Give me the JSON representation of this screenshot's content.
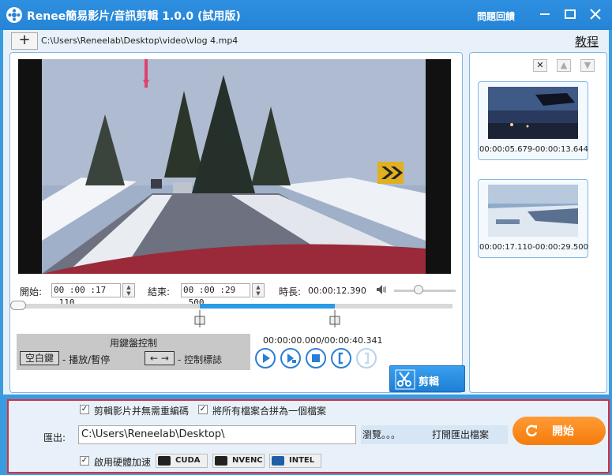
{
  "window": {
    "title": "Renee簡易影片/音訊剪輯 1.0.0 (試用版)",
    "feedback_label": "問題回饋"
  },
  "toolbar": {
    "add_label": "+",
    "file_path": "C:\\Users\\Reneelab\\Desktop\\video\\vlog 4.mp4",
    "tutorial_label": "教程"
  },
  "trim": {
    "start_label": "開始:",
    "start_value": "00 :00 :17 .110",
    "end_label": "結束:",
    "end_value": "00 :00 :29 .500",
    "duration_label": "時長:",
    "duration_value": "00:00:12.390"
  },
  "timeline": {
    "total_seconds": 40.341,
    "selection_start_seconds": 17.11,
    "selection_end_seconds": 29.5,
    "volume_fraction": 0.4
  },
  "keyboard": {
    "title": "用鍵盤控制",
    "space_key": "空白鍵",
    "space_desc": "- 播放/暫停",
    "arrow_key": "← →",
    "arrow_desc": "- 控制標誌"
  },
  "player": {
    "position_readout": "00:00:00.000/00:00:40.341",
    "cut_label": "剪輯"
  },
  "clips": [
    {
      "time_range": "00:00:05.679-00:00:13.644"
    },
    {
      "time_range": "00:00:17.110-00:00:29.500"
    }
  ],
  "clip_tools": {
    "delete": "✕",
    "up": "▲",
    "down": "▼"
  },
  "export": {
    "no_reencode_label": "剪輯影片并無需重編碼",
    "merge_label": "將所有檔案合拼為一個檔案",
    "export_label": "匯出:",
    "export_path": "C:\\Users\\Reneelab\\Desktop\\",
    "browse_label": "瀏覽。。。",
    "open_folder_label": "打開匯出檔案",
    "start_label": "開始",
    "hw_accel_label": "啟用硬體加速",
    "gpu": [
      "CUDA",
      "NVENC",
      "INTEL"
    ],
    "check_mark": "✓"
  },
  "colors": {
    "accent": "#2a9be6",
    "start_button": "#f68a1f",
    "export_border": "#d83040"
  }
}
